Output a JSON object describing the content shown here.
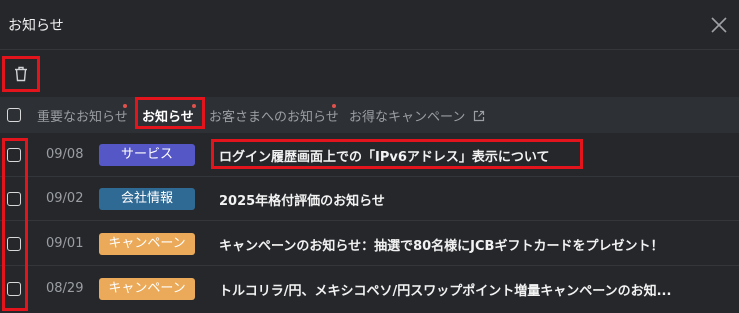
{
  "header": {
    "title": "お知らせ"
  },
  "tabs": [
    {
      "label": "重要なお知らせ",
      "dot": true
    },
    {
      "label": "お知らせ",
      "dot": true,
      "active": true
    },
    {
      "label": "お客さまへのお知らせ",
      "dot": true
    },
    {
      "label": "お得なキャンペーン",
      "external": true
    }
  ],
  "rows": [
    {
      "date": "09/08",
      "category": "サービス",
      "category_color": "#5557c6",
      "subject": "ログイン履歴画面上での「IPv6アドレス」表示について"
    },
    {
      "date": "09/02",
      "category": "会社情報",
      "category_color": "#2f6a95",
      "subject": "2025年格付評価のお知らせ"
    },
    {
      "date": "09/01",
      "category": "キャンペーン",
      "category_color": "#eaaa59",
      "subject": "キャンペーンのお知らせ：抽選で80名様にJCBギフトカードをプレゼント！"
    },
    {
      "date": "08/29",
      "category": "キャンペーン",
      "category_color": "#eaaa59",
      "subject": "トルコリラ/円、メキシコペソ/円スワップポイント増量キャンペーンのお知..."
    }
  ],
  "colors": {
    "background": "#25272b",
    "highlight": "#e3141c",
    "unread_dot": "#e0514b"
  },
  "icons": {
    "delete": "trash-icon",
    "close": "close-icon",
    "external": "external-link-icon"
  }
}
